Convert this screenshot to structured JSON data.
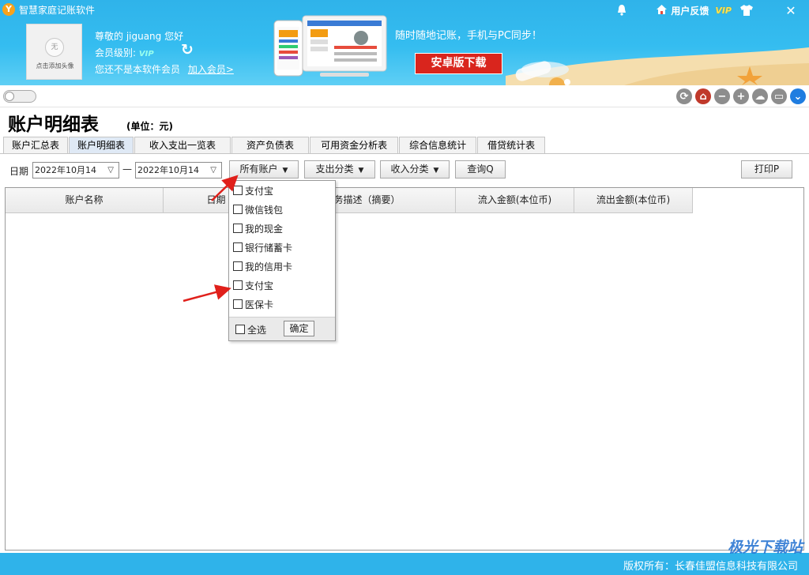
{
  "app": {
    "title": "智慧家庭记账软件",
    "logo_char": "Y"
  },
  "titlebar": {
    "feedback_label": "用户反馈",
    "vip_label": "VIP"
  },
  "user": {
    "greeting": "尊敬的 jiguang 您好",
    "level_label": "会员级别:",
    "level_value": "VIP",
    "not_member_text": "您还不是本软件会员",
    "join_link": "加入会员>",
    "avatar_placeholder": "点击添加头像",
    "avatar_circle_text": "无"
  },
  "promo": {
    "slogan": "随时随地记账，手机与PC同步！",
    "android_button": "安卓版下载"
  },
  "page": {
    "title": "账户明细表",
    "unit": "(单位：元)"
  },
  "tabs": [
    "账户汇总表",
    "账户明细表",
    "收入支出一览表",
    "资产负债表",
    "可用资金分析表",
    "综合信息统计",
    "借贷统计表"
  ],
  "active_tab": 1,
  "filters": {
    "date_label": "日期",
    "date_from": "2022年10月14",
    "date_to": "2022年10月14",
    "separator": "—",
    "accounts_button": "所有账户",
    "expense_button": "支出分类",
    "income_button": "收入分类",
    "query_button": "查询Q",
    "print_button": "打印P"
  },
  "table": {
    "columns": [
      "账户名称",
      "日期",
      "业务描述（摘要）",
      "流入金额(本位币)",
      "流出金额(本位币)"
    ]
  },
  "dropdown": {
    "items": [
      "支付宝",
      "微信钱包",
      "我的现金",
      "银行储蓄卡",
      "我的信用卡",
      "支付宝",
      "医保卡"
    ],
    "select_all": "全选",
    "confirm": "确定"
  },
  "footer": {
    "copyright": "版权所有：长春佳盟信息科技有限公司"
  },
  "watermark": "极光下载站",
  "colors": {
    "banner": "#2fb3ea",
    "android_button": "#d9251d",
    "annotation_arrow": "#e0201b"
  }
}
